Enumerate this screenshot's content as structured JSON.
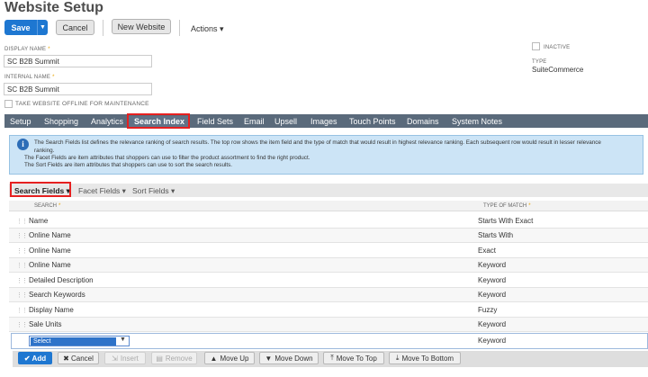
{
  "page": {
    "title": "Website Setup"
  },
  "toolbar": {
    "save_label": "Save",
    "save_caret": "▼",
    "cancel_label": "Cancel",
    "new_website_label": "New Website",
    "actions_label": "Actions ▾"
  },
  "form": {
    "display_name_label": "DISPLAY NAME",
    "display_name_value": "SC B2B Summit",
    "internal_name_label": "INTERNAL NAME",
    "internal_name_value": "SC B2B Summit",
    "offline_label": "TAKE WEBSITE OFFLINE FOR MAINTENANCE",
    "inactive_label": "INACTIVE",
    "type_label": "TYPE",
    "type_value": "SuiteCommerce",
    "required_marker": "*"
  },
  "tabs": [
    "Setup",
    "Shopping",
    "Analytics",
    "Search Index",
    "Field Sets",
    "Email",
    "Upsell",
    "Images",
    "Touch Points",
    "Domains",
    "System Notes"
  ],
  "info": {
    "icon": "i",
    "line1": "The Search Fields list defines the relevance ranking of search results. The top row shows the item field and the type of match that would result in highest relevance ranking. Each subsequent row would result in lesser relevance",
    "line2": "ranking.",
    "line3": "The Facet Fields are item attributes that shoppers can use to filter the product assortment to find the right product.",
    "line4": "The Sort Fields are item attributes that shoppers can use to sort the search results."
  },
  "subtabs": [
    "Search Fields ▾",
    "Facet Fields ▾",
    "Sort Fields ▾"
  ],
  "grid": {
    "col_search": "SEARCH",
    "col_match": "TYPE OF MATCH",
    "rows": [
      {
        "search": "Name",
        "match": "Starts With Exact"
      },
      {
        "search": "Online Name",
        "match": "Starts With"
      },
      {
        "search": "Online Name",
        "match": "Exact"
      },
      {
        "search": "Online Name",
        "match": "Keyword"
      },
      {
        "search": "Detailed Description",
        "match": "Keyword"
      },
      {
        "search": "Search Keywords",
        "match": "Keyword"
      },
      {
        "search": "Display Name",
        "match": "Fuzzy"
      },
      {
        "search": "Sale Units",
        "match": "Keyword"
      }
    ],
    "edit_row": {
      "select_value": "Select",
      "match": "Keyword"
    }
  },
  "machine_buttons": {
    "add": "✔ Add",
    "cancel": "✖ Cancel",
    "insert": "Insert",
    "remove": "Remove",
    "move_up": "Move Up",
    "move_down": "Move Down",
    "move_to_top": "Move To Top",
    "move_to_bottom": "Move To Bottom"
  },
  "colors": {
    "accent": "#1e77d1",
    "tabbar": "#5a6a7b",
    "highlight": "#e62020",
    "info_bg": "#cce4f6"
  }
}
